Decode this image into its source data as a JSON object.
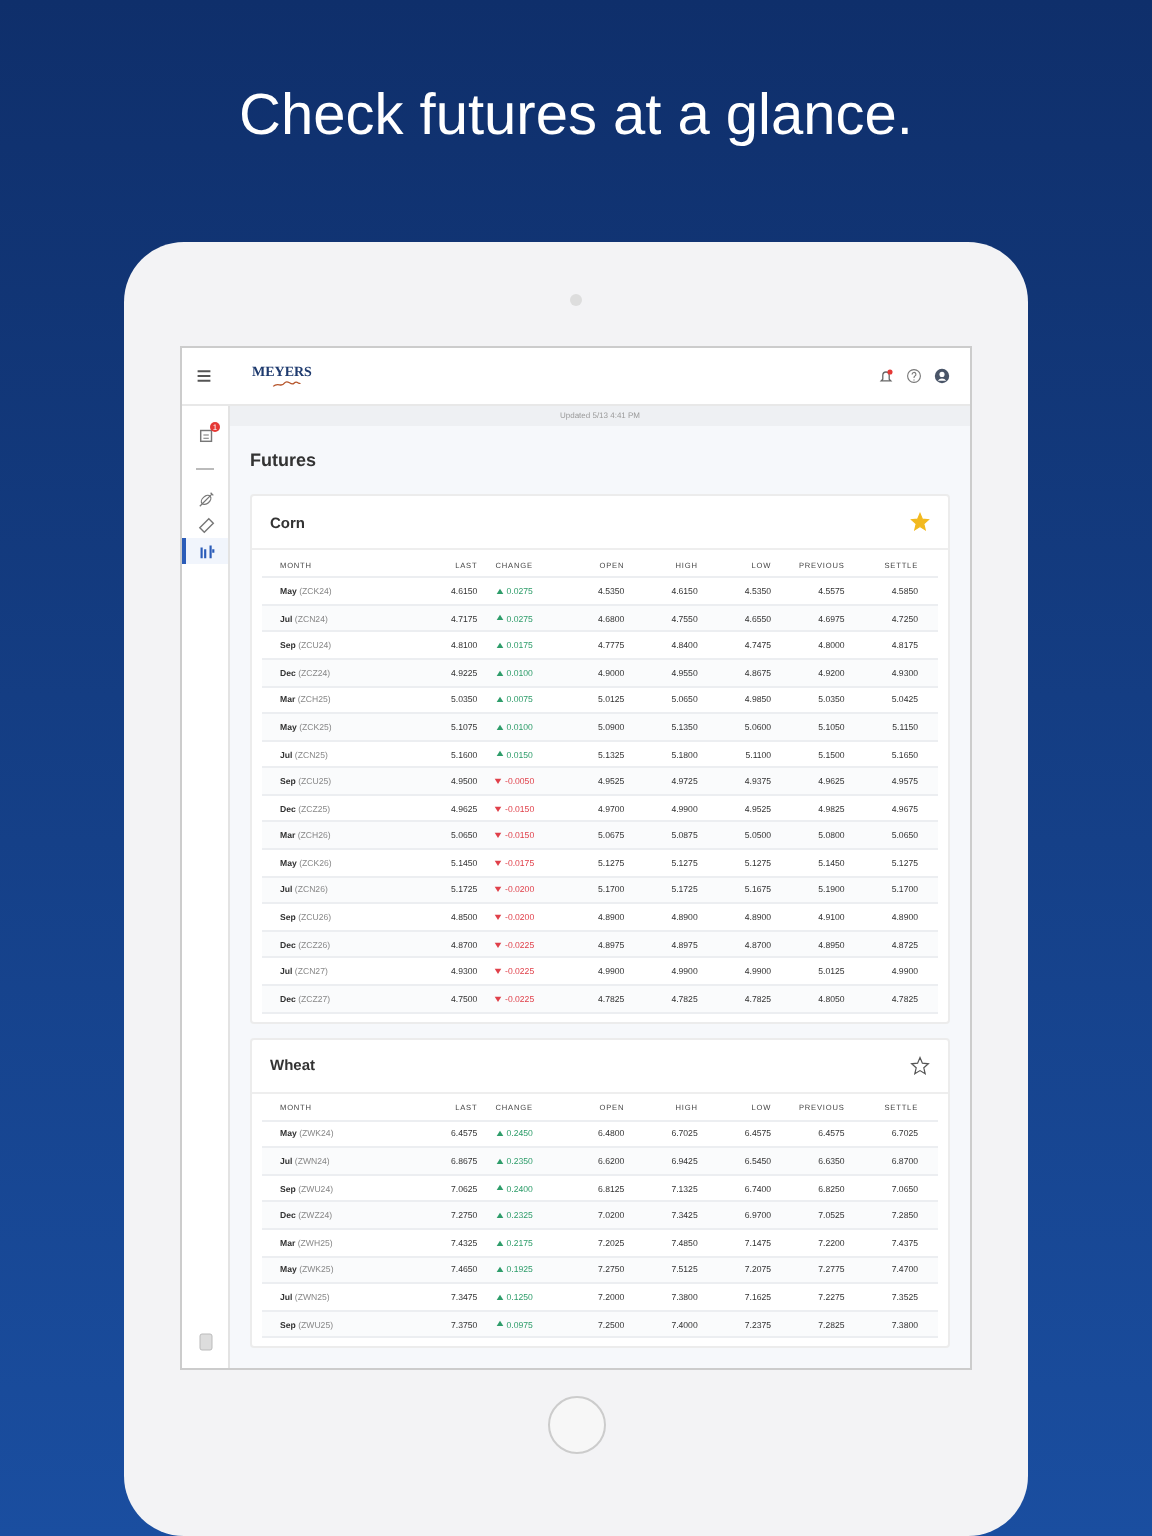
{
  "headline": "Check futures at a glance.",
  "app": {
    "logo": "MEYERS",
    "notifications": true,
    "updated": "Updated 5/13 4:41 PM",
    "sidebar": [
      {
        "badge": "1",
        "selected": false
      },
      {
        "selected": false
      },
      {
        "selected": false
      },
      {
        "selected": true
      }
    ],
    "page_title": "Futures",
    "cards": [
      {
        "title": "Corn",
        "favorite": true,
        "columns": [
          "MONTH",
          "LAST",
          "CHANGE",
          "OPEN",
          "HIGH",
          "LOW",
          "PREVIOUS",
          "SETTLE"
        ],
        "rows": [
          {
            "month": "May",
            "code": "(ZCK24)",
            "last": "4.6150",
            "kind": "up",
            "change": "0.0275",
            "open": "4.5350",
            "high": "4.6150",
            "low": "4.5350",
            "previous": "4.5575",
            "settle": "4.5850"
          },
          {
            "month": "Jul",
            "code": "(ZCN24)",
            "last": "4.7175",
            "kind": "up",
            "change": "0.0275",
            "open": "4.6800",
            "high": "4.7550",
            "low": "4.6550",
            "previous": "4.6975",
            "settle": "4.7250"
          },
          {
            "month": "Sep",
            "code": "(ZCU24)",
            "last": "4.8100",
            "kind": "up",
            "change": "0.0175",
            "open": "4.7775",
            "high": "4.8400",
            "low": "4.7475",
            "previous": "4.8000",
            "settle": "4.8175"
          },
          {
            "month": "Dec",
            "code": "(ZCZ24)",
            "last": "4.9225",
            "kind": "up",
            "change": "0.0100",
            "open": "4.9000",
            "high": "4.9550",
            "low": "4.8675",
            "previous": "4.9200",
            "settle": "4.9300"
          },
          {
            "month": "Mar",
            "code": "(ZCH25)",
            "last": "5.0350",
            "kind": "up",
            "change": "0.0075",
            "open": "5.0125",
            "high": "5.0650",
            "low": "4.9850",
            "previous": "5.0350",
            "settle": "5.0425"
          },
          {
            "month": "May",
            "code": "(ZCK25)",
            "last": "5.1075",
            "kind": "up",
            "change": "0.0100",
            "open": "5.0900",
            "high": "5.1350",
            "low": "5.0600",
            "previous": "5.1050",
            "settle": "5.1150"
          },
          {
            "month": "Jul",
            "code": "(ZCN25)",
            "last": "5.1600",
            "kind": "up",
            "change": "0.0150",
            "open": "5.1325",
            "high": "5.1800",
            "low": "5.1100",
            "previous": "5.1500",
            "settle": "5.1650"
          },
          {
            "month": "Sep",
            "code": "(ZCU25)",
            "last": "4.9500",
            "kind": "down",
            "change": "-0.0050",
            "open": "4.9525",
            "high": "4.9725",
            "low": "4.9375",
            "previous": "4.9625",
            "settle": "4.9575"
          },
          {
            "month": "Dec",
            "code": "(ZCZ25)",
            "last": "4.9625",
            "kind": "down",
            "change": "-0.0150",
            "open": "4.9700",
            "high": "4.9900",
            "low": "4.9525",
            "previous": "4.9825",
            "settle": "4.9675"
          },
          {
            "month": "Mar",
            "code": "(ZCH26)",
            "last": "5.0650",
            "kind": "down",
            "change": "-0.0150",
            "open": "5.0675",
            "high": "5.0875",
            "low": "5.0500",
            "previous": "5.0800",
            "settle": "5.0650"
          },
          {
            "month": "May",
            "code": "(ZCK26)",
            "last": "5.1450",
            "kind": "down",
            "change": "-0.0175",
            "open": "5.1275",
            "high": "5.1275",
            "low": "5.1275",
            "previous": "5.1450",
            "settle": "5.1275"
          },
          {
            "month": "Jul",
            "code": "(ZCN26)",
            "last": "5.1725",
            "kind": "down",
            "change": "-0.0200",
            "open": "5.1700",
            "high": "5.1725",
            "low": "5.1675",
            "previous": "5.1900",
            "settle": "5.1700"
          },
          {
            "month": "Sep",
            "code": "(ZCU26)",
            "last": "4.8500",
            "kind": "down",
            "change": "-0.0200",
            "open": "4.8900",
            "high": "4.8900",
            "low": "4.8900",
            "previous": "4.9100",
            "settle": "4.8900"
          },
          {
            "month": "Dec",
            "code": "(ZCZ26)",
            "last": "4.8700",
            "kind": "down",
            "change": "-0.0225",
            "open": "4.8975",
            "high": "4.8975",
            "low": "4.8700",
            "previous": "4.8950",
            "settle": "4.8725"
          },
          {
            "month": "Jul",
            "code": "(ZCN27)",
            "last": "4.9300",
            "kind": "down",
            "change": "-0.0225",
            "open": "4.9900",
            "high": "4.9900",
            "low": "4.9900",
            "previous": "5.0125",
            "settle": "4.9900"
          },
          {
            "month": "Dec",
            "code": "(ZCZ27)",
            "last": "4.7500",
            "kind": "down",
            "change": "-0.0225",
            "open": "4.7825",
            "high": "4.7825",
            "low": "4.7825",
            "previous": "4.8050",
            "settle": "4.7825"
          }
        ]
      },
      {
        "title": "Wheat",
        "favorite": false,
        "columns": [
          "MONTH",
          "LAST",
          "CHANGE",
          "OPEN",
          "HIGH",
          "LOW",
          "PREVIOUS",
          "SETTLE"
        ],
        "rows": [
          {
            "month": "May",
            "code": "(ZWK24)",
            "last": "6.4575",
            "kind": "up",
            "change": "0.2450",
            "open": "6.4800",
            "high": "6.7025",
            "low": "6.4575",
            "previous": "6.4575",
            "settle": "6.7025"
          },
          {
            "month": "Jul",
            "code": "(ZWN24)",
            "last": "6.8675",
            "kind": "up",
            "change": "0.2350",
            "open": "6.6200",
            "high": "6.9425",
            "low": "6.5450",
            "previous": "6.6350",
            "settle": "6.8700"
          },
          {
            "month": "Sep",
            "code": "(ZWU24)",
            "last": "7.0625",
            "kind": "up",
            "change": "0.2400",
            "open": "6.8125",
            "high": "7.1325",
            "low": "6.7400",
            "previous": "6.8250",
            "settle": "7.0650"
          },
          {
            "month": "Dec",
            "code": "(ZWZ24)",
            "last": "7.2750",
            "kind": "up",
            "change": "0.2325",
            "open": "7.0200",
            "high": "7.3425",
            "low": "6.9700",
            "previous": "7.0525",
            "settle": "7.2850"
          },
          {
            "month": "Mar",
            "code": "(ZWH25)",
            "last": "7.4325",
            "kind": "up",
            "change": "0.2175",
            "open": "7.2025",
            "high": "7.4850",
            "low": "7.1475",
            "previous": "7.2200",
            "settle": "7.4375"
          },
          {
            "month": "May",
            "code": "(ZWK25)",
            "last": "7.4650",
            "kind": "up",
            "change": "0.1925",
            "open": "7.2750",
            "high": "7.5125",
            "low": "7.2075",
            "previous": "7.2775",
            "settle": "7.4700"
          },
          {
            "month": "Jul",
            "code": "(ZWN25)",
            "last": "7.3475",
            "kind": "up",
            "change": "0.1250",
            "open": "7.2000",
            "high": "7.3800",
            "low": "7.1625",
            "previous": "7.2275",
            "settle": "7.3525"
          },
          {
            "month": "Sep",
            "code": "(ZWU25)",
            "last": "7.3750",
            "kind": "up",
            "change": "0.0975",
            "open": "7.2500",
            "high": "7.4000",
            "low": "7.2375",
            "previous": "7.2825",
            "settle": "7.3800"
          }
        ]
      }
    ]
  }
}
